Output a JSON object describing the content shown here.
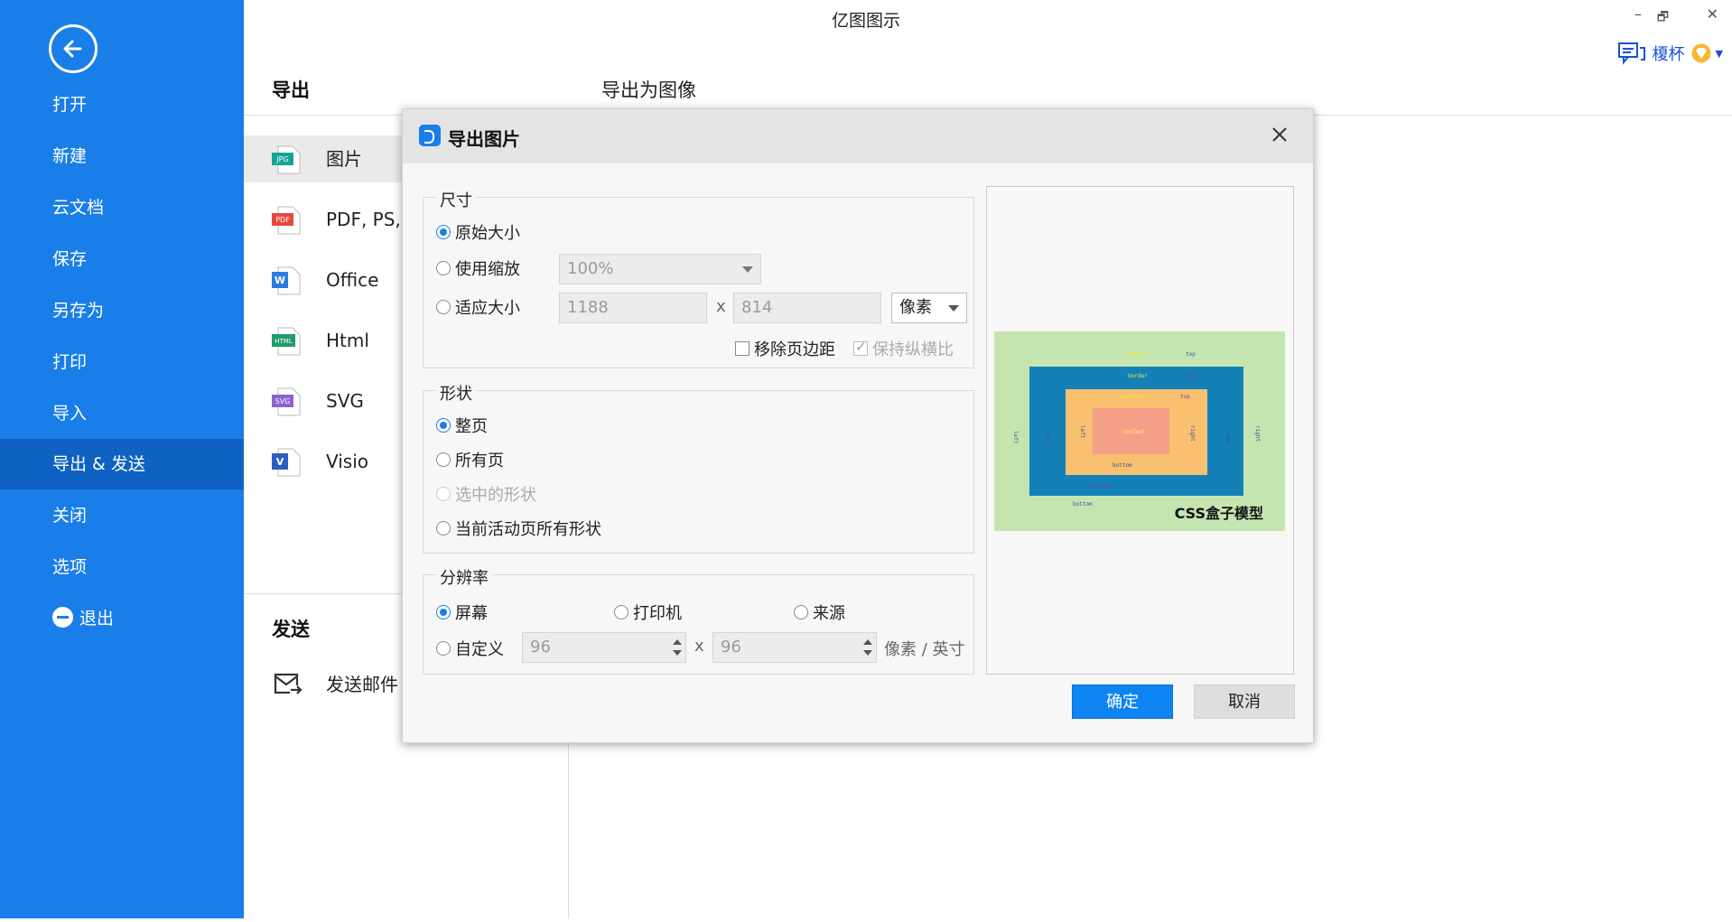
{
  "app": {
    "title": "亿图图示"
  },
  "window": {
    "minimize": "–",
    "restore": "🗗",
    "close": "✕"
  },
  "user": {
    "name": "榎杯",
    "icon": "chat-icon",
    "badge": "vip-diamond-icon"
  },
  "sidebar": {
    "back_icon": "arrow-left-icon",
    "items": [
      {
        "label": "打开"
      },
      {
        "label": "新建"
      },
      {
        "label": "云文档"
      },
      {
        "label": "保存"
      },
      {
        "label": "另存为"
      },
      {
        "label": "打印"
      },
      {
        "label": "导入"
      },
      {
        "label": "导出 & 发送",
        "active": true
      },
      {
        "label": "关闭"
      },
      {
        "label": "选项"
      },
      {
        "label": "退出",
        "icon": "minus-circle-icon"
      }
    ]
  },
  "export_panel": {
    "heading": "导出",
    "sub_heading": "导出为图像",
    "formats": [
      {
        "label": "图片",
        "icon": "jpg-file-icon",
        "tag": "JPG",
        "active": true
      },
      {
        "label": "PDF, PS,",
        "icon": "pdf-file-icon",
        "tag": "PDF"
      },
      {
        "label": "Office",
        "icon": "word-file-icon",
        "tag": "W"
      },
      {
        "label": "Html",
        "icon": "html-file-icon",
        "tag": "HTML"
      },
      {
        "label": "SVG",
        "icon": "svg-file-icon",
        "tag": "SVG"
      },
      {
        "label": "Visio",
        "icon": "visio-file-icon",
        "tag": "V"
      }
    ],
    "send_heading": "发送",
    "send_mail": {
      "label": "发送邮件",
      "icon": "mail-send-icon"
    }
  },
  "dialog": {
    "title": "导出图片",
    "size": {
      "legend": "尺寸",
      "original": "原始大小",
      "scale": "使用缩放",
      "scale_value": "100%",
      "fit": "适应大小",
      "width": "1188",
      "x": "x",
      "height": "814",
      "unit": "像素",
      "remove_margin": "移除页边距",
      "keep_ratio": "保持纵横比"
    },
    "shape": {
      "legend": "形状",
      "whole_page": "整页",
      "all_pages": "所有页",
      "selected": "选中的形状",
      "current_page_shapes": "当前活动页所有形状"
    },
    "resolution": {
      "legend": "分辨率",
      "screen": "屏幕",
      "printer": "打印机",
      "source": "来源",
      "custom": "自定义",
      "dpi_x": "96",
      "x": "x",
      "dpi_y": "96",
      "unit": "像素 / 英寸"
    },
    "preview": {
      "caption": "CSS盒子模型",
      "labels": {
        "margin": "margin",
        "border": "border",
        "padding": "padding",
        "content": "content",
        "top": "top",
        "bottom": "bottom",
        "left": "left",
        "right": "right"
      },
      "colors": {
        "margin": "#c5e5b0",
        "border": "#1381b8",
        "padding": "#f9c06f",
        "content": "#f4a088"
      }
    },
    "ok": "确定",
    "cancel": "取消"
  },
  "colors": {
    "sidebar": "#1a7ee8",
    "sidebar_active": "#0f62c1",
    "primary_button": "#0d84f2"
  }
}
